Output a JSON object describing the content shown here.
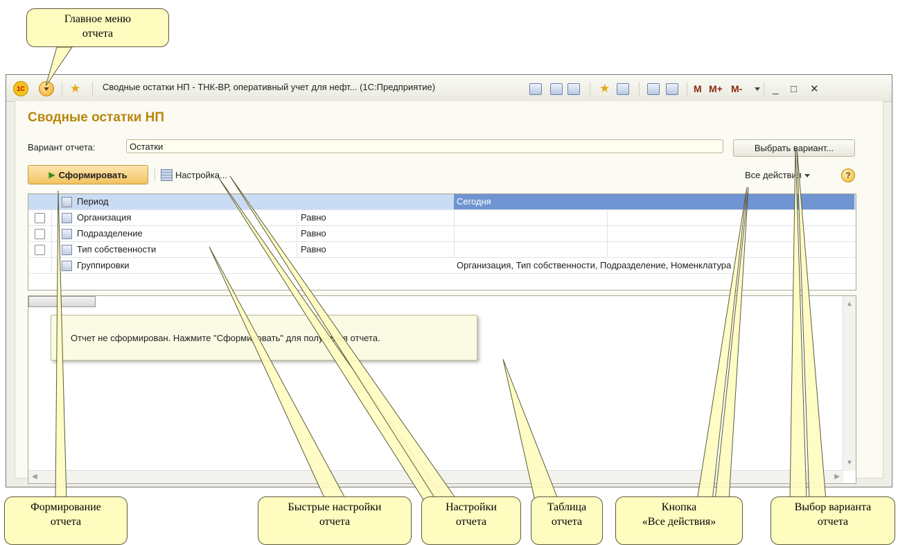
{
  "annotations": {
    "main_menu": [
      "Главное меню",
      "отчета"
    ],
    "generate": [
      "Формирование",
      "отчета"
    ],
    "quick_settings": [
      "Быстрые настройки",
      "отчета"
    ],
    "settings": [
      "Настройки",
      "отчета"
    ],
    "table": [
      "Таблица",
      "отчета"
    ],
    "all_actions": [
      "Кнопка",
      "«Все действия»"
    ],
    "variant_choice": [
      "Выбор варианта",
      "отчета"
    ]
  },
  "window": {
    "logo_text": "1С",
    "title": "Сводные остатки НП - ТНК-ВР, оперативный учет для нефт...  (1С:Предприятие)",
    "memory_buttons": [
      "M",
      "M+",
      "M-"
    ],
    "controls": [
      "_",
      "□",
      "✕"
    ]
  },
  "form": {
    "heading": "Сводные остатки НП",
    "variant_label": "Вариант отчета:",
    "variant_value": "Остатки",
    "choose_variant_button": "Выбрать вариант...",
    "generate_button": "Сформировать",
    "settings_button": "Настройка...",
    "all_actions_button": "Все действия",
    "help_button": "?"
  },
  "settings_grid": {
    "rows": [
      {
        "name": "Период",
        "condition": "",
        "value": "Сегодня",
        "checkbox": false
      },
      {
        "name": "Организация",
        "condition": "Равно",
        "value": "",
        "checkbox": true
      },
      {
        "name": "Подразделение",
        "condition": "Равно",
        "value": "",
        "checkbox": true
      },
      {
        "name": "Тип собственности",
        "condition": "Равно",
        "value": "",
        "checkbox": true
      },
      {
        "name": "Группировки",
        "condition": "",
        "value": "Организация, Тип собственности, Подразделение, Номенклатура",
        "checkbox": false
      }
    ]
  },
  "report_table": {
    "message": "Отчет не сформирован. Нажмите \"Сформировать\" для получения отчета."
  }
}
